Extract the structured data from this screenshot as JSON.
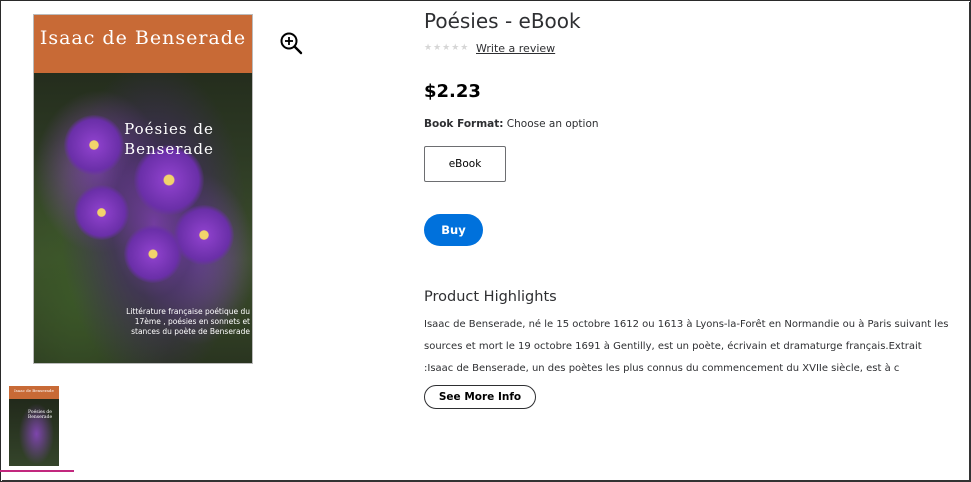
{
  "product": {
    "title": "Poésies - eBook",
    "rating_stars": "★★★★★",
    "write_review": "Write a review",
    "price": "$2.23",
    "format_label": "Book Format:",
    "format_hint": "Choose an option",
    "format_option": "eBook",
    "buy_label": "Buy"
  },
  "cover": {
    "author": "Isaac de Benserade",
    "title": "Poésies de Benserade",
    "subtitle": "Littérature française poétique du 17ème , poésies en sonnets et stances du poète de Benserade"
  },
  "highlights": {
    "heading": "Product Highlights",
    "body": "Isaac de Benserade, né le 15 octobre 1612 ou 1613 à Lyons-la-Forêt en Normandie ou à Paris suivant les sources et mort le 19 octobre 1691 à Gentilly, est un poète, écrivain et dramaturge français.Extrait :Isaac de Benserade, un des poètes les plus connus du commencement du XVIIe siècle, est à c",
    "more_label": "See More Info"
  },
  "icons": {
    "zoom": "zoom-in-icon"
  },
  "colors": {
    "accent": "#0071dc",
    "cover_band": "#c86a36",
    "thumb_indicator": "#c2287e"
  }
}
